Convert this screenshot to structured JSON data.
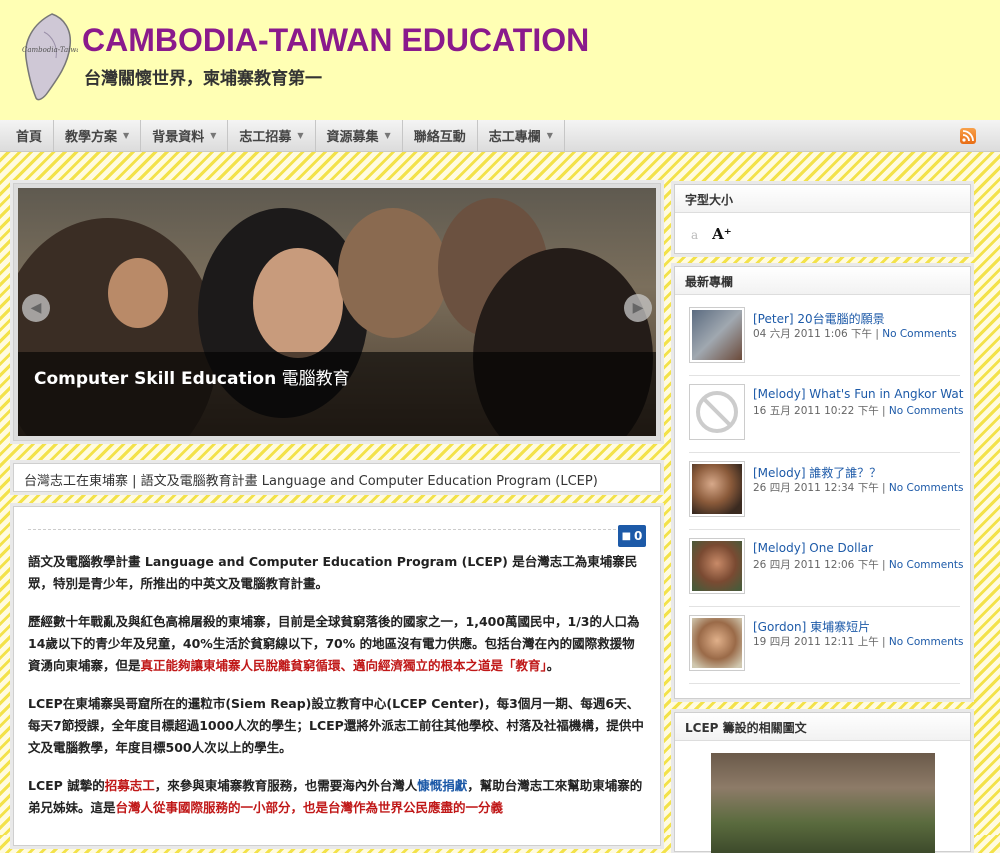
{
  "header": {
    "site_title": "CAMBODIA-TAIWAN EDUCATION",
    "tagline": "台灣關懷世界，柬埔寨教育第一",
    "logo_text": "Cambodia-Taiwan"
  },
  "nav": {
    "items": [
      {
        "label": "首頁",
        "dropdown": false
      },
      {
        "label": "教學方案",
        "dropdown": true
      },
      {
        "label": "背景資料",
        "dropdown": true
      },
      {
        "label": "志工招募",
        "dropdown": true
      },
      {
        "label": "資源募集",
        "dropdown": true
      },
      {
        "label": "聯絡互動",
        "dropdown": false
      },
      {
        "label": "志工專欄",
        "dropdown": true
      }
    ],
    "rss_icon": "rss-icon"
  },
  "slider": {
    "caption_en": "Computer Skill Education",
    "caption_zh": "電腦教育",
    "prev_icon": "◀",
    "next_icon": "▶"
  },
  "post": {
    "title": "台灣志工在東埔寨 | 語文及電腦教育計畫 Language and Computer Education Program (LCEP)",
    "comments_count": "0",
    "p1": "語文及電腦教學計畫 Language and Computer Education Program (LCEP) 是台灣志工為東埔寨民眾，特別是青少年，所推出的中英文及電腦教育計畫。",
    "p2_a": "歷經數十年戰亂及與紅色高棉屠殺的東埔寨，目前是全球貧窮落後的國家之一，1,400萬國民中，1/3的人口為14歲以下的青少年及兒童，40%生活於貧窮線以下，70% 的地區沒有電力供應。包括台灣在內的國際救援物資湧向東埔寨，但是",
    "p2_red": "真正能夠讓東埔寨人民脫離貧窮循環、邁向經濟獨立的根本之道是「教育」",
    "p2_b": "。",
    "p3": "LCEP在東埔寨吳哥窟所在的暹粒市(Siem Reap)設立教育中心(LCEP Center)，每3個月一期、每週6天、每天7節授課，全年度目標超過1000人次的學生；LCEP還將外派志工前往其他學校、村落及社福機構，提供中文及電腦教學，年度目標500人次以上的學生。",
    "p4_a": "LCEP 誠摯的",
    "p4_link1": "招募志工",
    "p4_b": "，來參與東埔寨教育服務，也需要海內外台灣人",
    "p4_link2": "慷慨捐獻",
    "p4_c": "，幫助台灣志工來幫助東埔寨的弟兄姊妹。這是",
    "p4_red": "台灣人從事國際服務的一小部分，也是台灣作為世界公民應盡的一分義"
  },
  "sidebar": {
    "fontsize": {
      "title": "字型大小",
      "small": "a",
      "large": "A⁺"
    },
    "latest": {
      "title": "最新專欄",
      "items": [
        {
          "title": "[Peter] 20台電腦的願景",
          "date": "04 六月 2011 1:06 下午",
          "sep": " | ",
          "comments": "No Comments",
          "thumb": "computers"
        },
        {
          "title": "[Melody] What's Fun in Angkor Wat",
          "date": "16 五月 2011 10:22 下午",
          "sep": " | ",
          "comments": "No Comments",
          "thumb": "no-image"
        },
        {
          "title": "[Melody] 誰救了誰？？",
          "date": "26 四月 2011 12:34 下午",
          "sep": " | ",
          "comments": "No Comments",
          "thumb": "kids"
        },
        {
          "title": "[Melody] One Dollar",
          "date": "26 四月 2011 12:06 下午",
          "sep": " | ",
          "comments": "No Comments",
          "thumb": "girl"
        },
        {
          "title": "[Gordon] 東埔寨短片",
          "date": "19 四月 2011 12:11 上午",
          "sep": " | ",
          "comments": "No Comments",
          "thumb": "smile"
        }
      ]
    },
    "photos": {
      "title": "LCEP 籌設的相關圖文"
    }
  }
}
